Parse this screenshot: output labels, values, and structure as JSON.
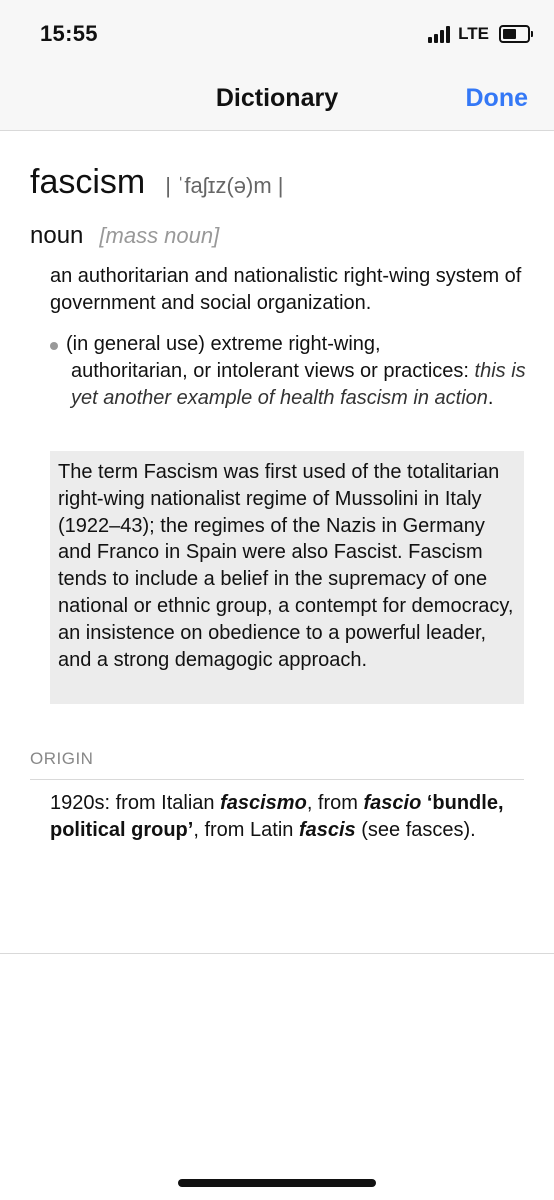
{
  "status_bar": {
    "time": "15:55",
    "network": "LTE",
    "battery_level": 0.55
  },
  "nav": {
    "title": "Dictionary",
    "done_label": "Done"
  },
  "entry": {
    "headword": "fascism",
    "pronunciation": "| ˈfaʃɪz(ə)m |",
    "part_of_speech": "noun",
    "grammar_note": "[mass noun]",
    "sense1": "an authoritarian and nationalistic right-wing system of government and social organization.",
    "sense2": {
      "line1": "(in general use) extreme right-wing,",
      "line2": "authoritarian, or intolerant views or practices:",
      "example": "this is yet another example of health fascism in action",
      "example_end": "."
    },
    "usage_note": "The term Fascism was first used of the totalitarian right-wing nationalist regime of Mussolini in Italy (1922–43); the regimes of the Nazis in Germany and Franco in Spain were also Fascist. Fascism tends to include a belief in the supremacy of one national or ethnic group, a contempt for democracy, an insistence on obedience to a powerful leader, and a strong demagogic approach."
  },
  "origin": {
    "label": "ORIGIN",
    "parts": [
      {
        "text": "1920s: from Italian ",
        "style": "plain"
      },
      {
        "text": "fascismo",
        "style": "bold-italic"
      },
      {
        "text": ", from ",
        "style": "plain"
      },
      {
        "text": "fascio",
        "style": "bold-italic"
      },
      {
        "text": " ‘bundle, political group’",
        "style": "bold"
      },
      {
        "text": ", from Latin ",
        "style": "plain"
      },
      {
        "text": "fascis",
        "style": "bold-italic"
      },
      {
        "text": " (see fasces).",
        "style": "plain"
      }
    ]
  },
  "icons": {
    "signal": "cellular-signal-icon",
    "battery": "battery-icon"
  }
}
